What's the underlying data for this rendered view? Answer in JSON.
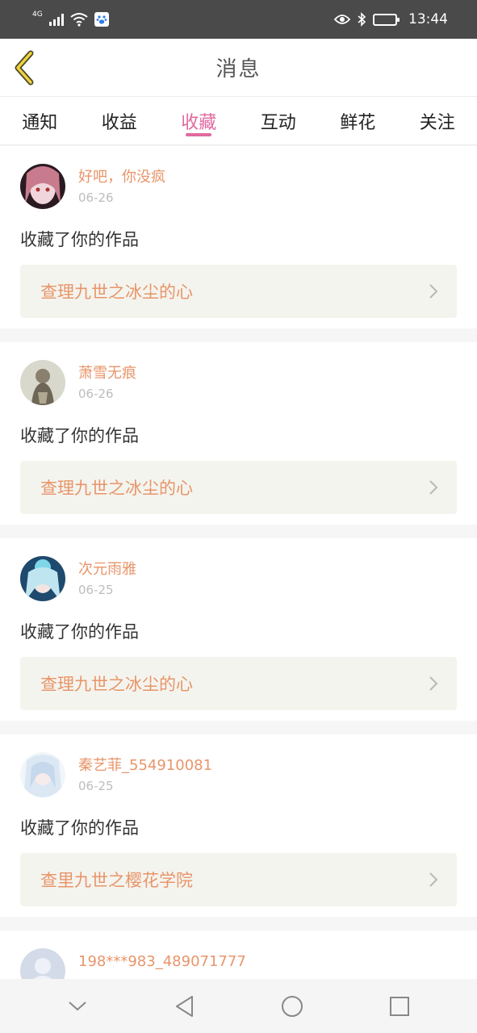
{
  "status_bar": {
    "network": "4G",
    "time": "13:44"
  },
  "header": {
    "title": "消息"
  },
  "tabs": [
    {
      "label": "通知",
      "active": false
    },
    {
      "label": "收益",
      "active": false
    },
    {
      "label": "收藏",
      "active": true
    },
    {
      "label": "互动",
      "active": false
    },
    {
      "label": "鲜花",
      "active": false
    },
    {
      "label": "关注",
      "active": false
    }
  ],
  "messages": [
    {
      "user": "好吧，你没疯",
      "date": "06-26",
      "action": "收藏了你的作品",
      "work": "查理九世之冰尘的心"
    },
    {
      "user": "萧雪无痕",
      "date": "06-26",
      "action": "收藏了你的作品",
      "work": "查理九世之冰尘的心"
    },
    {
      "user": "次元雨雅",
      "date": "06-25",
      "action": "收藏了你的作品",
      "work": "查理九世之冰尘的心"
    },
    {
      "user": "秦艺菲_554910081",
      "date": "06-25",
      "action": "收藏了你的作品",
      "work": "查里九世之樱花学院"
    },
    {
      "user": "198***983_489071777"
    }
  ],
  "colors": {
    "accent": "#e06aa0",
    "username": "#e8956a",
    "link_bg": "#f4f4ee"
  }
}
